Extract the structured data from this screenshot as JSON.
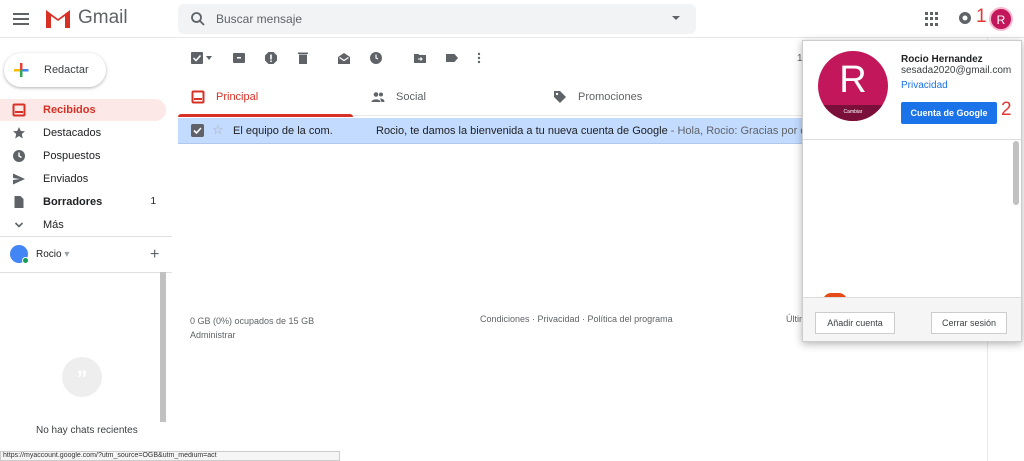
{
  "header": {
    "app_name": "Gmail",
    "search_placeholder": "Buscar mensaje",
    "avatar_letter": "R",
    "annotation_1": "1",
    "annotation_2": "2"
  },
  "sidebar": {
    "compose_label": "Redactar",
    "items": [
      {
        "label": "Recibidos",
        "count": "",
        "icon": "inbox-icon"
      },
      {
        "label": "Destacados",
        "count": "",
        "icon": "star-icon"
      },
      {
        "label": "Pospuestos",
        "count": "",
        "icon": "clock-icon"
      },
      {
        "label": "Enviados",
        "count": "",
        "icon": "send-icon"
      },
      {
        "label": "Borradores",
        "count": "1",
        "icon": "draft-icon"
      },
      {
        "label": "Más",
        "count": "",
        "icon": "chevron-down-icon"
      }
    ],
    "hangouts_user": "Rocio",
    "hangouts_user_caret": "▾",
    "no_chats": "No hay chats recientes"
  },
  "toolbar": {
    "page_count": "1"
  },
  "tabs": [
    {
      "label": "Principal",
      "icon": "inbox-icon"
    },
    {
      "label": "Social",
      "icon": "people-icon"
    },
    {
      "label": "Promociones",
      "icon": "tag-icon"
    }
  ],
  "emails": [
    {
      "sender": "El equipo de la com.",
      "subject": "Rocio, te damos la bienvenida a tu nueva cuenta de Google",
      "snippet": " - Hola, Rocio: Gracias por crear un"
    }
  ],
  "footer": {
    "storage": "0 GB (0%) ocupados de 15 GB",
    "manage": "Administrar",
    "links": "Condiciones · Privacidad · Política del programa",
    "last_activity": "Últin"
  },
  "account_popup": {
    "name": "Rocio Hernandez",
    "email": "sesada2020@gmail.com",
    "privacy": "Privacidad",
    "google_account_button": "Cuenta de Google",
    "change_photo": "Cambiar",
    "add_account": "Añadir cuenta",
    "sign_out": "Cerrar sesión",
    "avatar_letter": "R"
  },
  "status_bar": {
    "url": "https://myaccount.google.com/?utm_source=OGB&utm_medium=act"
  },
  "colors": {
    "accent_red": "#d93025",
    "avatar_pink": "#c2185b",
    "selected_row": "#c2dbff",
    "google_blue": "#1a73e8"
  }
}
